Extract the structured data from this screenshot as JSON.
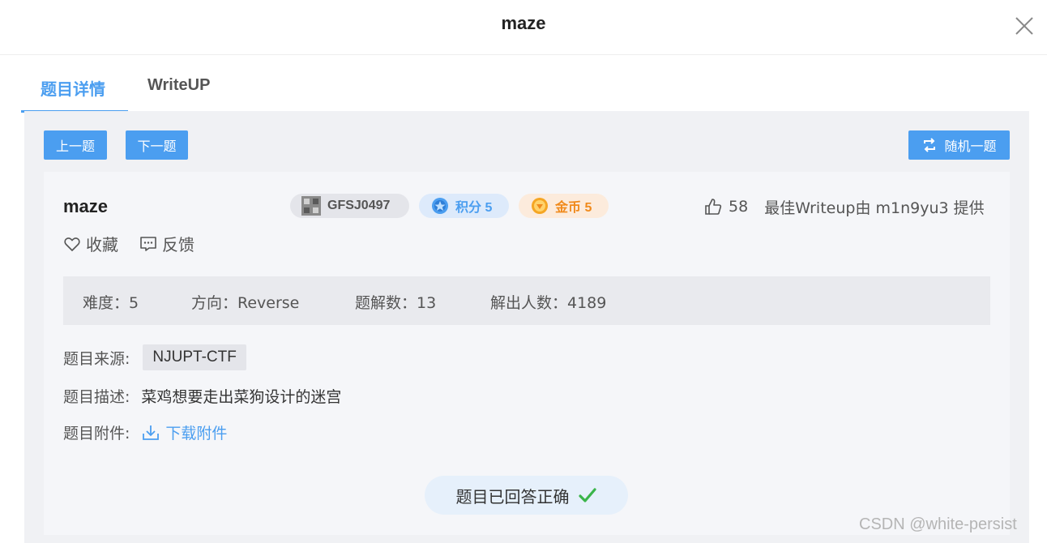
{
  "header": {
    "title": "maze"
  },
  "tabs": [
    {
      "label": "题目详情",
      "active": true
    },
    {
      "label": "WriteUP",
      "active": false
    }
  ],
  "nav": {
    "prev_label": "上一题",
    "next_label": "下一题",
    "random_label": "随机一题"
  },
  "challenge": {
    "name": "maze",
    "id": "GFSJ0497",
    "score_label": "积分 5",
    "coin_label": "金币 5",
    "likes": "58",
    "best_writeup": "最佳Writeup由 m1n9yu3 提供",
    "favorite_label": "收藏",
    "feedback_label": "反馈"
  },
  "stats": [
    {
      "label": "难度：5"
    },
    {
      "label": "方向：Reverse"
    },
    {
      "label": "题解数：13"
    },
    {
      "label": "解出人数：4189"
    }
  ],
  "details": {
    "source_label": "题目来源:",
    "source_value": "NJUPT-CTF",
    "desc_label": "题目描述:",
    "desc_value": "菜鸡想要走出菜狗设计的迷宫",
    "attach_label": "题目附件:",
    "attach_link": "下载附件"
  },
  "status": {
    "solved_text": "题目已回答正确"
  },
  "watermark": "CSDN @white-persist",
  "colors": {
    "accent": "#4b9ef0",
    "coin": "#f08a1c",
    "success": "#3bb54a"
  }
}
